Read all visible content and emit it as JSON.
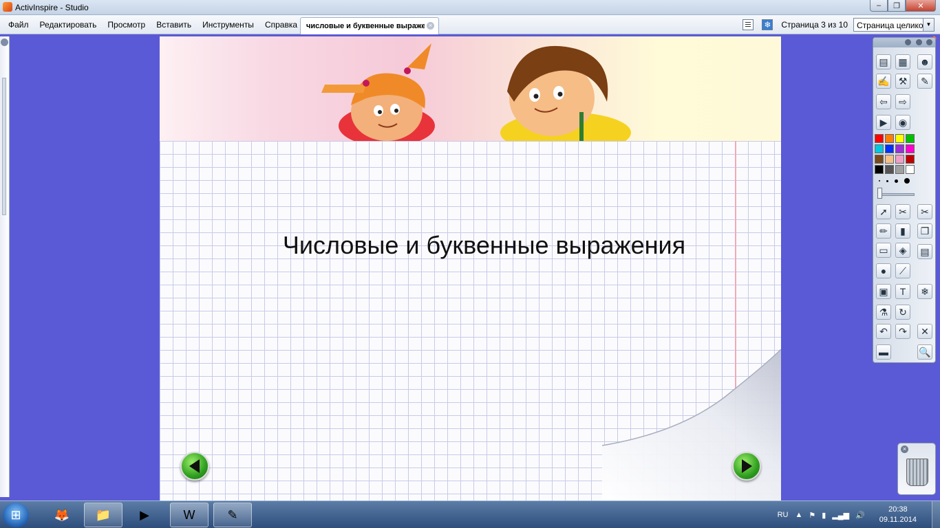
{
  "window": {
    "title": "ActivInspire - Studio",
    "buttons": {
      "minimize": "‒",
      "restore": "❐",
      "close": "✕"
    }
  },
  "menu": {
    "items": [
      "Файл",
      "Редактировать",
      "Просмотр",
      "Вставить",
      "Инструменты",
      "Справка"
    ]
  },
  "document_tab": {
    "label": "числовые и буквенные выражения",
    "close": "×"
  },
  "pageinfo": {
    "text": "Страница 3 из 10"
  },
  "zoom": {
    "value": "Страница целиком"
  },
  "slide": {
    "title": "Числовые и буквенные выражения"
  },
  "palette": {
    "colors": [
      "#ff0000",
      "#ff8000",
      "#ffff00",
      "#00c000",
      "#00c8e0",
      "#0030ff",
      "#9b30d8",
      "#ff00cc",
      "#7a4a1a",
      "#f5c08a",
      "#f0a0c8",
      "#c00000",
      "#000000",
      "#555555",
      "#a0a0a0",
      "#ffffff"
    ]
  },
  "toolbox_icons": [
    "pages-icon",
    "profile-icon",
    "user-icon",
    "pen-sign-icon",
    "tools-icon",
    "edit-profile-icon",
    "page-back-icon",
    "page-forward-icon",
    "play-icon",
    "earth-icon",
    "select-icon",
    "magic-icon",
    "pen-icon",
    "highlighter-icon",
    "eraser-icon",
    "fill-icon",
    "shape-icon",
    "connector-icon",
    "clip-icon",
    "text-icon",
    "flask-icon",
    "reset-icon",
    "undo-icon",
    "redo-icon",
    "save-icon"
  ],
  "taskbar": {
    "items": [
      "firefox-icon",
      "explorer-icon",
      "media-player-icon",
      "word-icon",
      "activinspire-icon"
    ],
    "lang": "RU",
    "time": "20:38",
    "date": "09.11.2014"
  }
}
